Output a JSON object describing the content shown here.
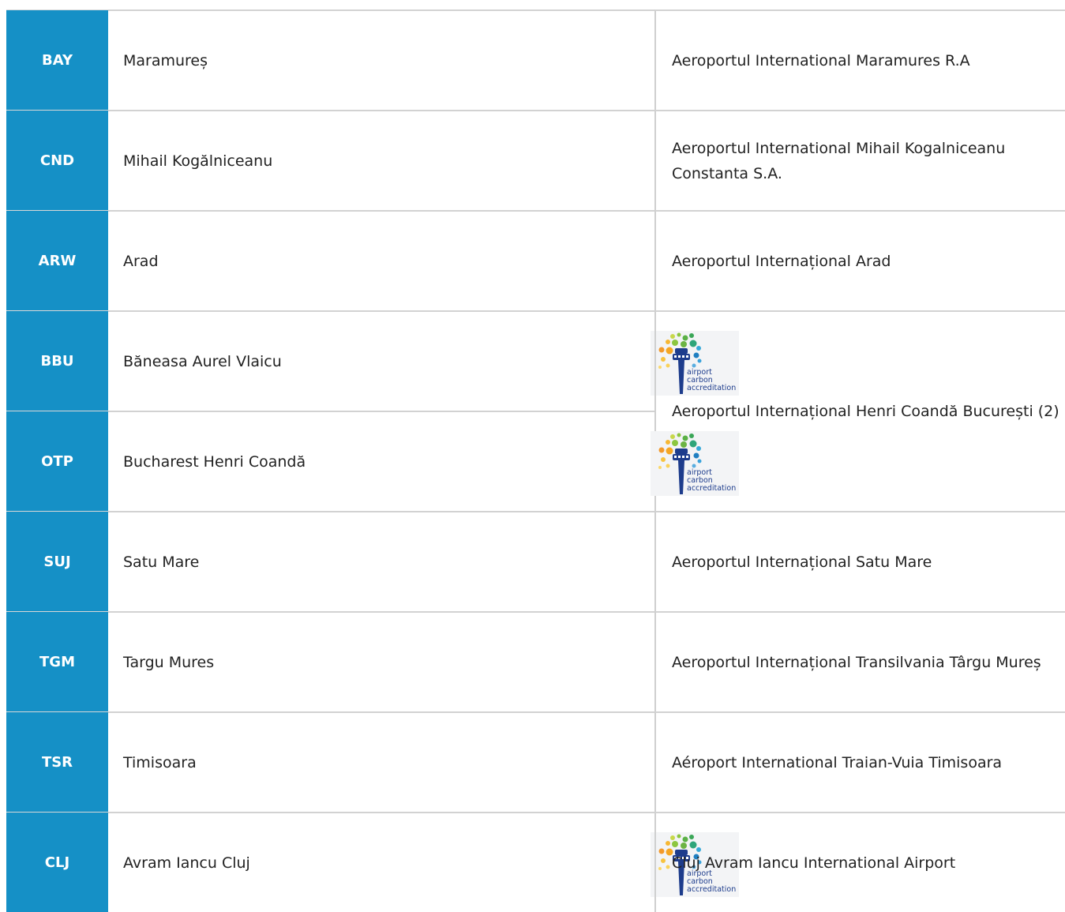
{
  "rows": [
    {
      "code": "BAY",
      "name": "Maramureș",
      "operator": "Aeroportul International Maramures R.A",
      "aca": false
    },
    {
      "code": "CND",
      "name": "Mihail Kogălniceanu",
      "operator": "Aeroportul International Mihail Kogalniceanu Constanta S.A.",
      "aca": false
    },
    {
      "code": "ARW",
      "name": "Arad",
      "operator": "Aeroportul Internațional Arad",
      "aca": false
    },
    {
      "code": "BBU",
      "name": "Băneasa Aurel Vlaicu",
      "operator": "Aeroportul Internațional Henri Coandă București (2)",
      "aca": true
    },
    {
      "code": "OTP",
      "name": "Bucharest Henri Coandă",
      "operator": "",
      "aca": true
    },
    {
      "code": "SUJ",
      "name": "Satu Mare",
      "operator": "Aeroportul Internațional Satu Mare",
      "aca": false
    },
    {
      "code": "TGM",
      "name": "Targu Mures",
      "operator": "Aeroportul Internațional Transilvania Târgu Mureș",
      "aca": false
    },
    {
      "code": "TSR",
      "name": "Timisoara",
      "operator": "Aéroport International Traian-Vuia Timisoara",
      "aca": false
    },
    {
      "code": "CLJ",
      "name": "Avram Iancu Cluj",
      "operator": "Cluj Avram Iancu International Airport",
      "aca": true
    }
  ],
  "aca_badge": {
    "icon": "airport-carbon-accreditation-logo-icon",
    "line1": "airport",
    "line2": "carbon",
    "line3": "accreditation"
  },
  "colors": {
    "code_background": "#1590c6",
    "code_text": "#ffffff",
    "border": "#d2d2d2",
    "text": "#222222"
  }
}
